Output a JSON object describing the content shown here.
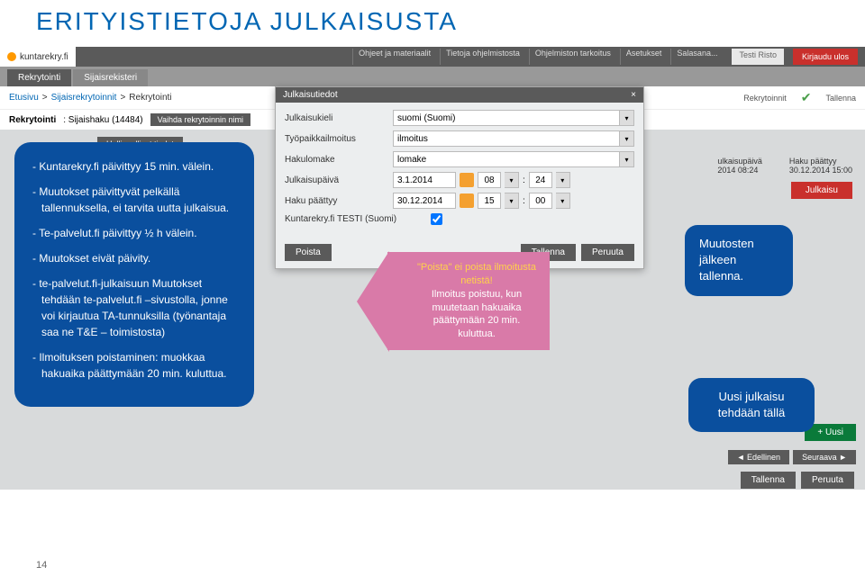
{
  "page_title": "ERITYISTIETOJA JULKAISUSTA",
  "logo": "kuntarekry.fi",
  "top_links": [
    "Ohjeet ja materiaalit",
    "Tietoja ohjelmistosta",
    "Ohjelmiston tarkoitus",
    "Asetukset",
    "Salasana..."
  ],
  "user": "Testi Risto",
  "logout": "Kirjaudu ulos",
  "main_tabs": {
    "active": "Rekrytointi",
    "inactive": "Sijaisrekisteri"
  },
  "breadcrumb": {
    "a": "Etusivu",
    "b": "Sijaisrekrytoinnit",
    "c": "Rekrytointi"
  },
  "crumb_right": {
    "a": "Rekrytoinnit",
    "b": "Tallenna"
  },
  "subhead": {
    "label": "Rekrytointi",
    "id": ": Sijaishaku (14484)",
    "btn": "Vaihda rekrytoinnin nimi"
  },
  "section_tab": "Hallinnolliset tiedot",
  "right_info": {
    "col1_label": "ulkaisupäivä",
    "col1_val": "2014 08:24",
    "col2_label": "Haku päättyy",
    "col2_val": "30.12.2014 15:00"
  },
  "julkaisu_btn": "Julkaisu",
  "modal": {
    "title": "Julkaisutiedot",
    "rows": {
      "lang_label": "Julkaisukieli",
      "lang_val": "suomi (Suomi)",
      "notice_label": "Työpaikkailmoitus",
      "notice_val": "ilmoitus",
      "form_label": "Hakulomake",
      "form_val": "lomake",
      "date_label": "Julkaisupäivä",
      "date_val": "3.1.2014",
      "date_h": "08",
      "date_m": "24",
      "end_label": "Haku päättyy",
      "end_val": "30.12.2014",
      "end_h": "15",
      "end_m": "00",
      "test_label": "Kuntarekry.fi TESTI (Suomi)"
    },
    "foot": {
      "del": "Poista",
      "save": "Tallenna",
      "cancel": "Peruuta"
    }
  },
  "callout_left": [
    "Kuntarekry.fi päivittyy 15 min. välein.",
    "Muutokset päivittyvät pelkällä tallennuksella, ei tarvita uutta julkaisua.",
    "Te-palvelut.fi päivittyy ½ h välein.",
    "Muutokset eivät päivity.",
    "te-palvelut.fi-julkaisuun Muutokset tehdään te-palvelut.fi –sivustolla, jonne voi kirjautua TA-tunnuksilla (työnantaja saa ne T&E – toimistosta)",
    "Ilmoituksen poistaminen: muokkaa hakuaika päättymään 20 min. kuluttua."
  ],
  "arrow": {
    "l1": "\"Poista\" ei poista ilmoitusta netistä!",
    "l2": "Ilmoitus poistuu, kun muutetaan hakuaika päättymään 20 min. kuluttua."
  },
  "cg1": "Muutosten jälkeen tallenna.",
  "cg2": "Uusi julkaisu tehdään tällä",
  "uusi": "Uusi",
  "nav": {
    "prev": "◄ Edellinen",
    "next": "Seuraava ►"
  },
  "pagenum": "14"
}
